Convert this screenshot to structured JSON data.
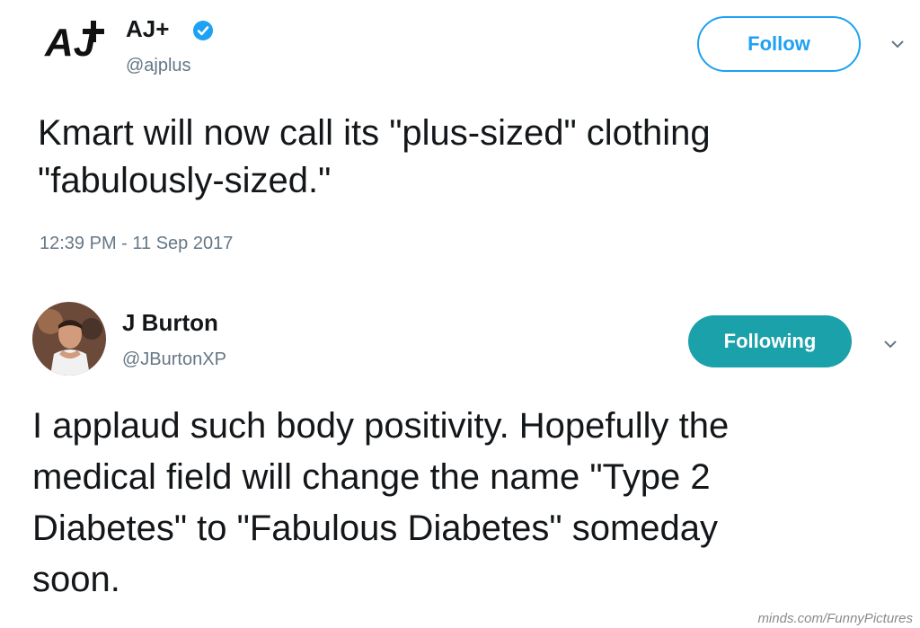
{
  "tweet": {
    "author_name": "AJ+",
    "author_handle": "@ajplus",
    "follow_label": "Follow",
    "text_line1": "Kmart will now call its \"plus-sized\" clothing",
    "text_line2": "\"fabulously-sized.\"",
    "timestamp": "12:39 PM - 11 Sep 2017",
    "logo_text": "AJ+"
  },
  "reply": {
    "author_name": "J Burton",
    "author_handle": "@JBurtonXP",
    "following_label": "Following",
    "text_line1": "I applaud such body positivity. Hopefully the",
    "text_line2": "medical field will change the name \"Type 2",
    "text_line3": "Diabetes\" to \"Fabulous Diabetes\" someday",
    "text_line4": "soon."
  },
  "watermark": "minds.com/FunnyPictures",
  "colors": {
    "follow_blue": "#1da1f2",
    "following_teal": "#1aa1a9",
    "muted_gray": "#657786"
  },
  "icons": {
    "logo": "aj-plus-logo",
    "verified": "verified-badge-icon",
    "chevron": "chevron-down-icon",
    "avatar": "user-avatar"
  }
}
